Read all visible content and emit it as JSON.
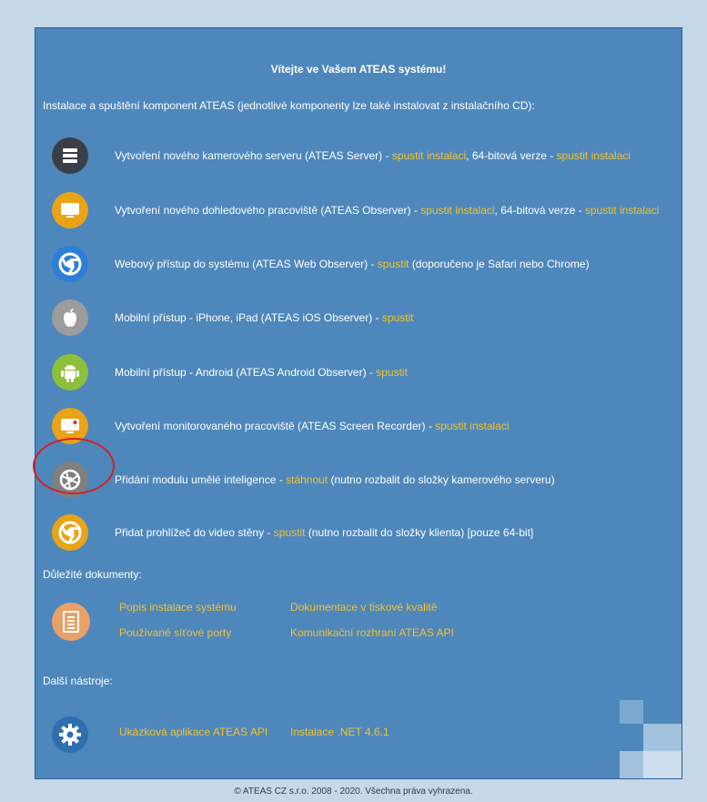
{
  "title": "Vítejte ve Vašem ATEAS systému!",
  "intro": "Instalace a spuštění komponent ATEAS (jednotlivé komponenty lze také instalovat z instalačního CD):",
  "components": [
    {
      "icon": "server-icon",
      "color": "#3a3f47",
      "parts": [
        {
          "t": "Vytvoření nového kamerového serveru (ATEAS Server) - "
        },
        {
          "t": "spustit instalaci",
          "link": true
        },
        {
          "t": ", 64-bitová verze - "
        },
        {
          "t": "spustit instalaci",
          "link": true
        }
      ]
    },
    {
      "icon": "monitor-icon",
      "color": "#e8a317",
      "parts": [
        {
          "t": "Vytvoření nového dohledového pracoviště (ATEAS Observer) - "
        },
        {
          "t": "spustit instalaci",
          "link": true
        },
        {
          "t": ", 64-bitová verze - "
        },
        {
          "t": "spustit instalaci",
          "link": true
        }
      ]
    },
    {
      "icon": "chrome-icon",
      "color": "#2c7fd6",
      "parts": [
        {
          "t": "Webový přístup do systému (ATEAS Web Observer) - "
        },
        {
          "t": "spustit",
          "link": true
        },
        {
          "t": " (doporučeno je Safari nebo Chrome)"
        }
      ]
    },
    {
      "icon": "apple-icon",
      "color": "#9c9c9c",
      "parts": [
        {
          "t": "Mobilní přístup - iPhone, iPad (ATEAS iOS Observer) - "
        },
        {
          "t": "spustit",
          "link": true
        }
      ]
    },
    {
      "icon": "android-icon",
      "color": "#8dbf3a",
      "parts": [
        {
          "t": "Mobilní přístup - Android (ATEAS Android Observer) - "
        },
        {
          "t": "spustit",
          "link": true
        }
      ]
    },
    {
      "icon": "screen-recorder-icon",
      "color": "#e8a317",
      "parts": [
        {
          "t": "Vytvoření monitorovaného pracoviště (ATEAS Screen Recorder) - "
        },
        {
          "t": "spustit instalaci",
          "link": true
        }
      ]
    },
    {
      "icon": "ai-module-icon",
      "color": "#808080",
      "parts": [
        {
          "t": "Přidání modulu umělé inteligence - "
        },
        {
          "t": "stáhnout",
          "link": true
        },
        {
          "t": " (nutno rozbalit do složky kamerového serveru)"
        }
      ]
    },
    {
      "icon": "chrome-icon",
      "color": "#e8a317",
      "parts": [
        {
          "t": "Přidat prohlížeč do video stěny - "
        },
        {
          "t": "spustit",
          "link": true
        },
        {
          "t": " (nutno rozbalit do složky klienta) [pouze 64-bit]"
        }
      ]
    }
  ],
  "docs": {
    "heading": "Důležité dokumenty:",
    "icon": "document-icon",
    "links": [
      "Popis instalace systému",
      "Dokumentace v tiskové kvalitě",
      "Používané síťové porty",
      "Komunikační rozhraní ATEAS API"
    ]
  },
  "tools": {
    "heading": "Další nástroje:",
    "icon": "gear-icon",
    "links": [
      "Ukázková aplikace ATEAS API",
      "Instalace .NET 4.6.1"
    ]
  },
  "footer": "© ATEAS CZ s.r.o. 2008 - 2020. Všechna práva vyhrazena."
}
